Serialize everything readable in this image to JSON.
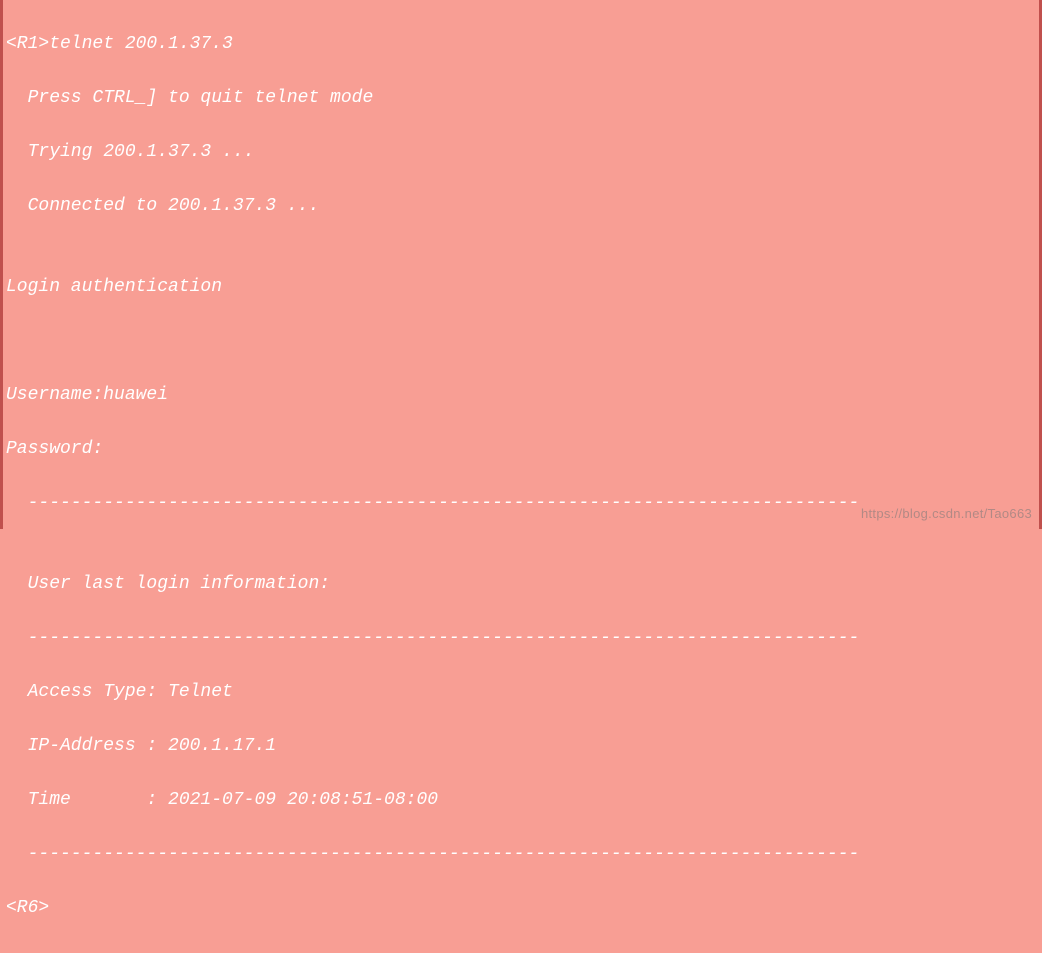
{
  "lines": {
    "l0": "<R1>telnet 200.1.37.3",
    "l1": "  Press CTRL_] to quit telnet mode",
    "l2": "  Trying 200.1.37.3 ...",
    "l3": "  Connected to 200.1.37.3 ...",
    "l4": "",
    "l5": "Login authentication",
    "l6": "",
    "l7": "",
    "l8": "Username:huawei",
    "l9": "Password:",
    "l10": "  -----------------------------------------------------------------------------",
    "l11": "",
    "l12": "  User last login information:",
    "l13": "  -----------------------------------------------------------------------------",
    "l14": "  Access Type: Telnet",
    "l15": "  IP-Address : 200.1.17.1",
    "l16": "  Time       : 2021-07-09 20:08:51-08:00",
    "l17": "  -----------------------------------------------------------------------------",
    "l18": "<R6>"
  },
  "watermark": "https://blog.csdn.net/Tao663"
}
